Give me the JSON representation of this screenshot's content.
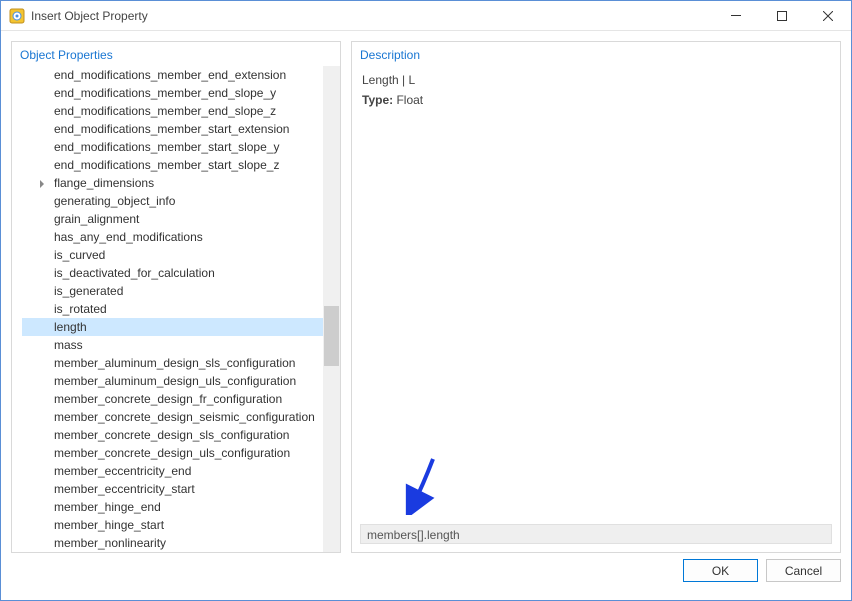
{
  "window": {
    "title": "Insert Object Property"
  },
  "leftPanel": {
    "title": "Object Properties"
  },
  "rightPanel": {
    "title": "Description",
    "descLine1": "Length | L",
    "typeLabel": "Type:",
    "typeValue": " Float",
    "pathValue": "members[].length"
  },
  "tree": {
    "items": [
      {
        "label": "end_modifications_member_end_extension",
        "expandable": false
      },
      {
        "label": "end_modifications_member_end_slope_y",
        "expandable": false
      },
      {
        "label": "end_modifications_member_end_slope_z",
        "expandable": false
      },
      {
        "label": "end_modifications_member_start_extension",
        "expandable": false
      },
      {
        "label": "end_modifications_member_start_slope_y",
        "expandable": false
      },
      {
        "label": "end_modifications_member_start_slope_z",
        "expandable": false
      },
      {
        "label": "flange_dimensions",
        "expandable": true
      },
      {
        "label": "generating_object_info",
        "expandable": false
      },
      {
        "label": "grain_alignment",
        "expandable": false
      },
      {
        "label": "has_any_end_modifications",
        "expandable": false
      },
      {
        "label": "is_curved",
        "expandable": false
      },
      {
        "label": "is_deactivated_for_calculation",
        "expandable": false
      },
      {
        "label": "is_generated",
        "expandable": false
      },
      {
        "label": "is_rotated",
        "expandable": false
      },
      {
        "label": "length",
        "expandable": false,
        "selected": true
      },
      {
        "label": "mass",
        "expandable": false
      },
      {
        "label": "member_aluminum_design_sls_configuration",
        "expandable": false
      },
      {
        "label": "member_aluminum_design_uls_configuration",
        "expandable": false
      },
      {
        "label": "member_concrete_design_fr_configuration",
        "expandable": false
      },
      {
        "label": "member_concrete_design_seismic_configuration",
        "expandable": false
      },
      {
        "label": "member_concrete_design_sls_configuration",
        "expandable": false
      },
      {
        "label": "member_concrete_design_uls_configuration",
        "expandable": false
      },
      {
        "label": "member_eccentricity_end",
        "expandable": false
      },
      {
        "label": "member_eccentricity_start",
        "expandable": false
      },
      {
        "label": "member_hinge_end",
        "expandable": false
      },
      {
        "label": "member_hinge_start",
        "expandable": false
      },
      {
        "label": "member_nonlinearity",
        "expandable": false
      }
    ]
  },
  "buttons": {
    "ok": "OK",
    "cancel": "Cancel"
  }
}
